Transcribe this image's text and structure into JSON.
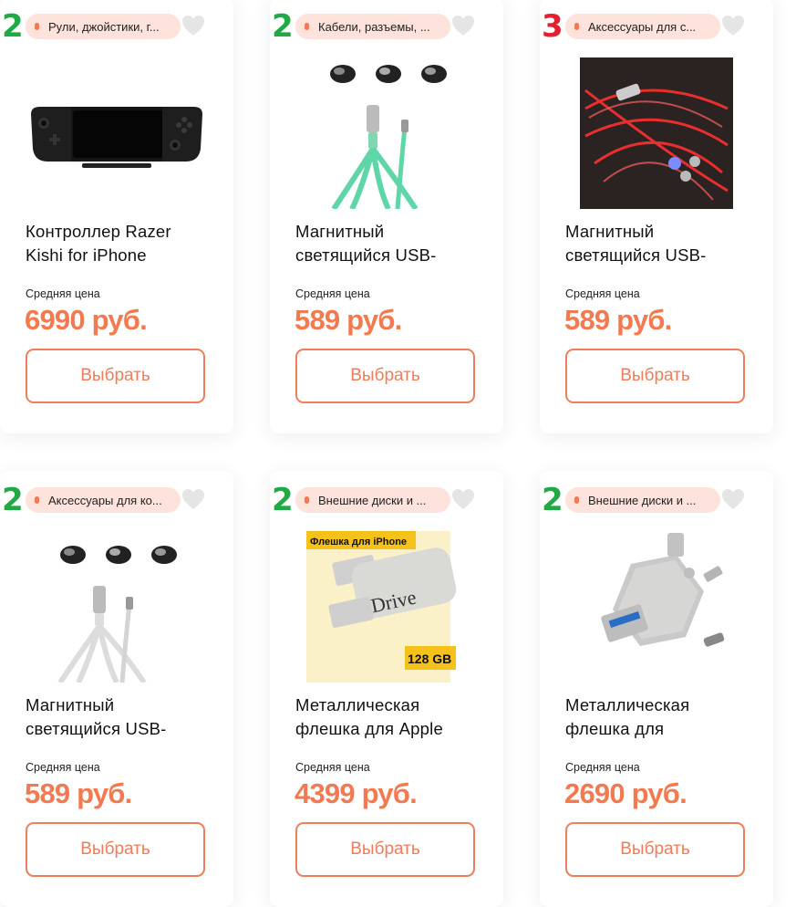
{
  "products": [
    {
      "rank": "2",
      "rank_color": "#1faa45",
      "category": "Рули, джойстики, г...",
      "image_icon": "game-controller-image",
      "title_line1": "Контроллер Razer",
      "title_line2": "Kishi for iPhone",
      "price_label": "Средняя цена",
      "price": "6990 руб.",
      "button_label": "Выбрать"
    },
    {
      "rank": "2",
      "rank_color": "#1faa45",
      "category": "Кабели, разъемы, ...",
      "image_icon": "magnetic-cable-image",
      "title_line1": "Магнитный",
      "title_line2": "светящийся USB-",
      "price_label": "Средняя цена",
      "price": "589 руб.",
      "button_label": "Выбрать"
    },
    {
      "rank": "3",
      "rank_color": "#e3202e",
      "category": "Аксессуары для с...",
      "image_icon": "glowing-cable-image",
      "title_line1": "Магнитный",
      "title_line2": "светящийся USB-",
      "price_label": "Средняя цена",
      "price": "589 руб.",
      "button_label": "Выбрать"
    },
    {
      "rank": "2",
      "rank_color": "#1faa45",
      "category": "Аксессуары для ко...",
      "image_icon": "magnetic-cable-image",
      "title_line1": "Магнитный",
      "title_line2": "светящийся USB-",
      "price_label": "Средняя цена",
      "price": "589 руб.",
      "button_label": "Выбрать"
    },
    {
      "rank": "2",
      "rank_color": "#1faa45",
      "category": "Внешние диски и ...",
      "image_icon": "usb-flash-drive-image",
      "image_text_banner": "Флешка для iPhone",
      "image_text_brand": "iDrive",
      "image_text_capacity": "128 GB",
      "title_line1": "Металлическая",
      "title_line2": "флешка для Apple",
      "price_label": "Средняя цена",
      "price": "4399 руб.",
      "button_label": "Выбрать"
    },
    {
      "rank": "2",
      "rank_color": "#1faa45",
      "category": "Внешние диски и ...",
      "image_icon": "otg-flash-drive-image",
      "title_line1": "Металлическая",
      "title_line2": "флешка для",
      "price_label": "Средняя цена",
      "price": "2690 руб.",
      "button_label": "Выбрать"
    }
  ],
  "colors": {
    "accent": "#f37a50",
    "tag_bg": "#fde3dc",
    "rank_green": "#1faa45",
    "rank_red": "#e3202e"
  }
}
